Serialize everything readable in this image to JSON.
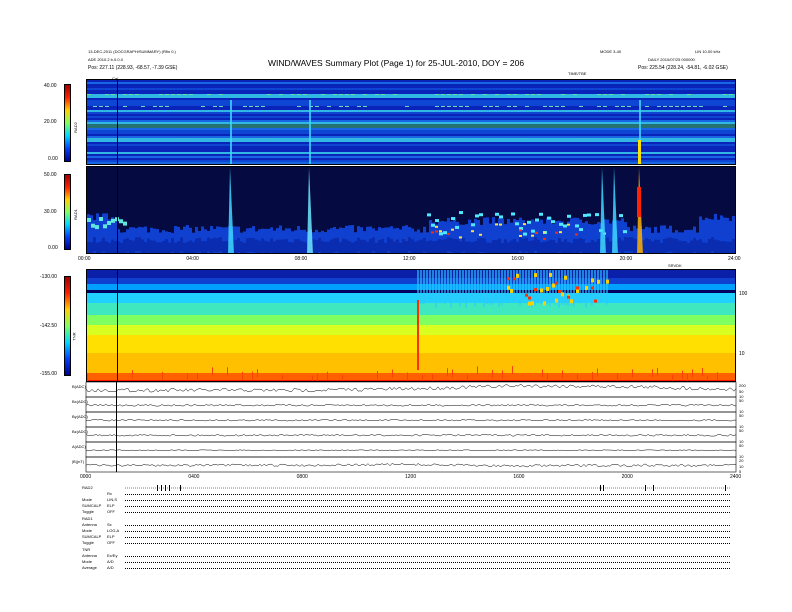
{
  "header": {
    "title": "WIND/WAVES Summary Plot (Page 1) for 25-JUL-2010, DOY = 206",
    "left_line1": "13-DEC-2011 (DOCGRAPH/SUMMARY) (Rfin 0.)",
    "left_line2": "ADE 2010.2 b.0.0.0",
    "left_pos": "Pos:   227.11 (228.93, -68.57, -7.39 GSE)",
    "right_line1": "MODE 3-40",
    "right_line2": "DAILY 2010/07/25 000000",
    "right_pos": "Pos:   225.54 (228.24, -54.81, -6.02 GSE)",
    "right_corner": "LIN 10.00 kHz",
    "top_center_label": "TIME/TBE",
    "cal_mark": "Cal"
  },
  "colors": {
    "background": "#ffffff",
    "spectro_low": "#0a14a0",
    "spectro_mid": "#00c8ff",
    "spectro_high": "#ff2200",
    "axis": "#000000"
  },
  "chart_data": [
    {
      "type": "heatmap",
      "panel": "RAD2",
      "ylabel": "RAD2",
      "colorbar_ticks": [
        "40.00",
        "20.00",
        "0.00"
      ],
      "colorbar_range": [
        0,
        40
      ],
      "x_range_hours": [
        0,
        24
      ]
    },
    {
      "type": "heatmap",
      "panel": "RAD1",
      "ylabel": "RAD1",
      "colorbar_ticks": [
        "50.00",
        "30.00",
        "0.00"
      ],
      "colorbar_range": [
        0,
        50
      ],
      "x_ticks": [
        "00:00",
        "04:00",
        "08:00",
        "12:00",
        "16:00",
        "20:00",
        "24:00"
      ],
      "x_ticks_hours": [
        0,
        4,
        8,
        12,
        16,
        20,
        24
      ],
      "corner_label": "SRVDK"
    },
    {
      "type": "heatmap",
      "panel": "TNR",
      "ylabel": "TNR",
      "colorbar_ticks": [
        "-130.00",
        "-142.50",
        "-155.00"
      ],
      "colorbar_range": [
        -155,
        -130
      ],
      "right_axis_ticks": [
        "100",
        "10"
      ]
    },
    {
      "type": "line",
      "panels": [
        {
          "label": "B(ADC)",
          "right_ticks": [
            "200",
            "50",
            "10"
          ],
          "noise": 0.12,
          "trend": [
            0,
            0,
            0,
            0.2,
            0.6,
            0.5,
            0.1
          ]
        },
        {
          "label": "Bx(ADC)",
          "right_ticks": [
            "50",
            "10"
          ],
          "noise": 0.06,
          "trend": [
            0,
            0,
            0,
            0,
            0,
            0,
            0
          ]
        },
        {
          "label": "By(ADC)",
          "right_ticks": [
            "50",
            "10"
          ],
          "noise": 0.05,
          "trend": [
            0,
            0,
            0,
            0,
            0,
            0,
            0
          ]
        },
        {
          "label": "Bz(ADC)",
          "right_ticks": [
            "50",
            "10"
          ],
          "noise": 0.06,
          "trend": [
            0,
            0,
            0,
            0,
            0,
            0,
            0
          ]
        },
        {
          "label": "A(ADC)",
          "right_ticks": [
            "50",
            "10"
          ],
          "noise": 0.03,
          "trend": [
            0,
            0,
            0,
            0,
            0,
            0,
            0
          ]
        },
        {
          "label": "|B|(nT)",
          "right_ticks": [
            "20",
            "10",
            "5"
          ],
          "noise": 0.08,
          "trend": [
            0,
            0,
            0,
            0.1,
            -0.1,
            0,
            0
          ]
        }
      ],
      "x_ticks": [
        "0000",
        "0400",
        "0800",
        "1200",
        "1600",
        "2000",
        "2400"
      ],
      "x_ticks_hours": [
        0,
        4,
        8,
        12,
        16,
        20,
        24
      ]
    }
  ],
  "modes": {
    "rad2": {
      "title": "RAD2",
      "rows": [
        [
          "",
          "Rx"
        ],
        [
          "Mode",
          "LIN,S"
        ],
        [
          "SUMCALP",
          "ELP"
        ],
        [
          "Toggle",
          "OFF"
        ]
      ]
    },
    "rad1": {
      "title": "RAD1",
      "rows": [
        [
          "Antenna",
          "Sx"
        ],
        [
          "Mode",
          "LOG,A"
        ],
        [
          "SUMCALP",
          "ELP"
        ],
        [
          "Toggle",
          "OFF"
        ]
      ]
    },
    "tnr": {
      "title": "TNR",
      "rows": [
        [
          "Antenna",
          "Ex/Ey"
        ],
        [
          "Mode",
          "A/D"
        ],
        [
          "Average",
          "A/D"
        ]
      ]
    }
  }
}
